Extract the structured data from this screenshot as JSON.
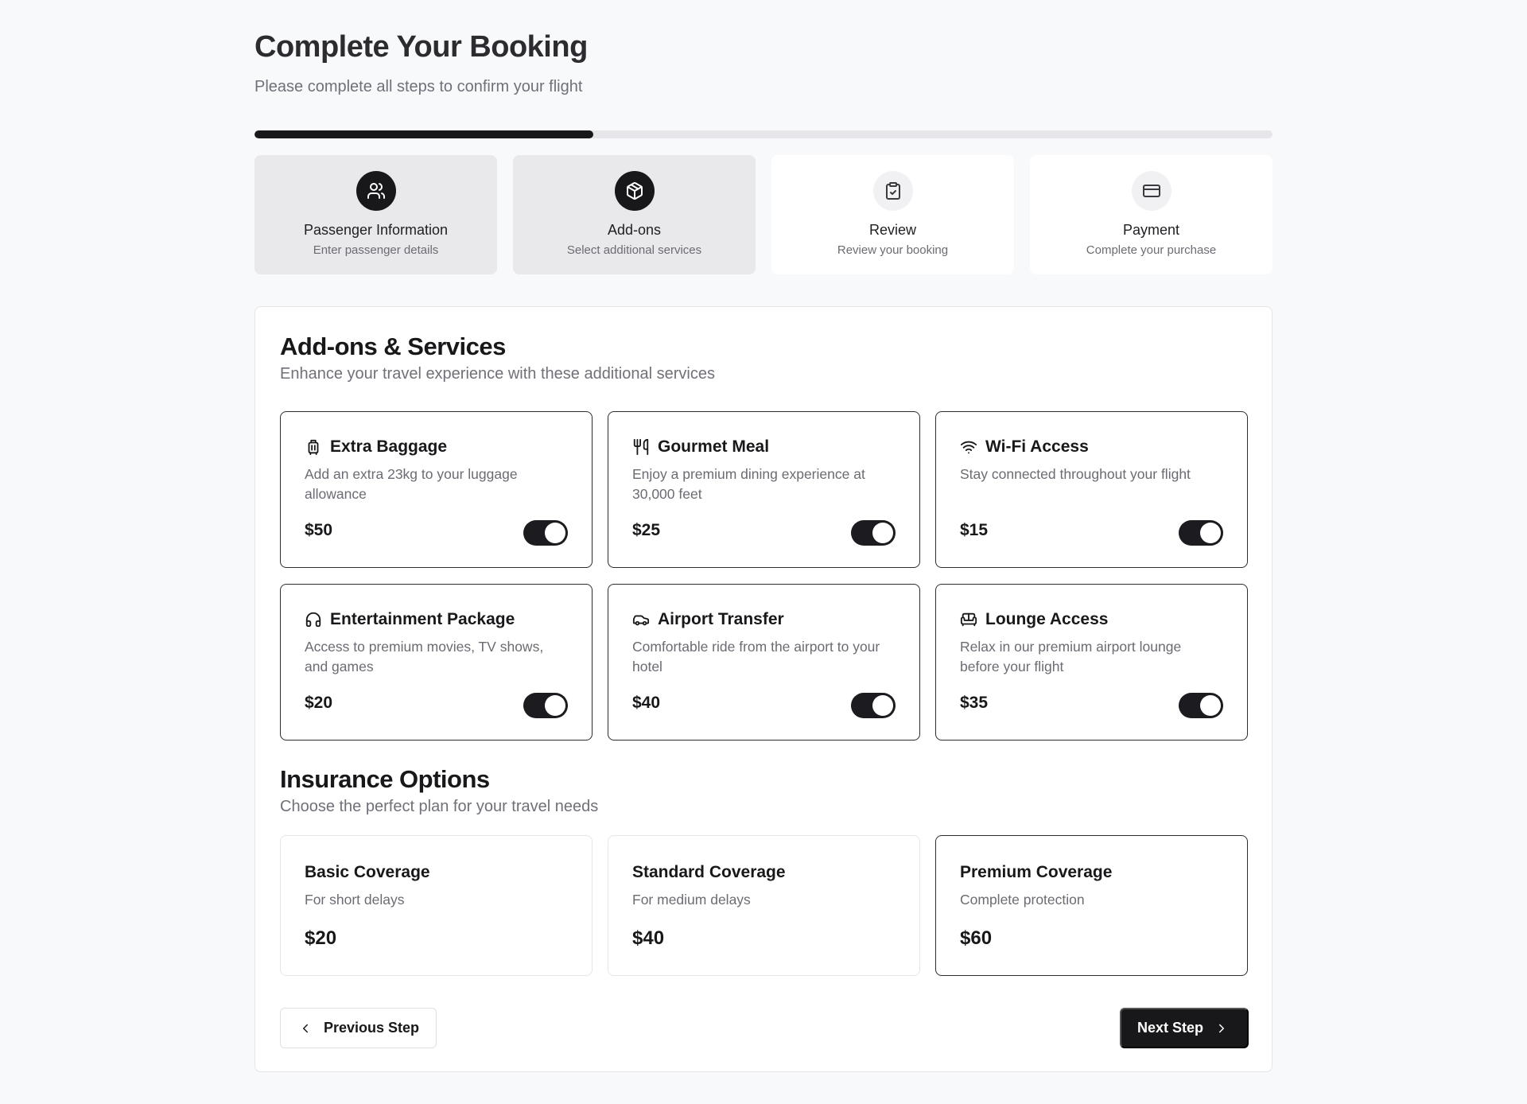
{
  "header": {
    "title": "Complete Your Booking",
    "subtitle": "Please complete all steps to confirm your flight"
  },
  "progress": {
    "percent": 33.3
  },
  "steps": [
    {
      "title": "Passenger Information",
      "subtitle": "Enter passenger details",
      "icon": "users-icon",
      "status": "done"
    },
    {
      "title": "Add-ons",
      "subtitle": "Select additional services",
      "icon": "package-icon",
      "status": "current"
    },
    {
      "title": "Review",
      "subtitle": "Review your booking",
      "icon": "clipboard-check-icon",
      "status": "upcoming"
    },
    {
      "title": "Payment",
      "subtitle": "Complete your purchase",
      "icon": "credit-card-icon",
      "status": "upcoming"
    }
  ],
  "addons": {
    "title": "Add-ons & Services",
    "subtitle": "Enhance your travel experience with these additional services",
    "items": [
      {
        "name": "Extra Baggage",
        "description": "Add an extra 23kg to your luggage allowance",
        "price": "$50",
        "icon": "luggage-icon",
        "enabled": true
      },
      {
        "name": "Gourmet Meal",
        "description": "Enjoy a premium dining experience at 30,000 feet",
        "price": "$25",
        "icon": "utensils-icon",
        "enabled": true
      },
      {
        "name": "Wi-Fi Access",
        "description": "Stay connected throughout your flight",
        "price": "$15",
        "icon": "wifi-icon",
        "enabled": true
      },
      {
        "name": "Entertainment Package",
        "description": "Access to premium movies, TV shows, and games",
        "price": "$20",
        "icon": "headphones-icon",
        "enabled": true
      },
      {
        "name": "Airport Transfer",
        "description": "Comfortable ride from the airport to your hotel",
        "price": "$40",
        "icon": "car-icon",
        "enabled": true
      },
      {
        "name": "Lounge Access",
        "description": "Relax in our premium airport lounge before your flight",
        "price": "$35",
        "icon": "sofa-icon",
        "enabled": true
      }
    ]
  },
  "insurance": {
    "title": "Insurance Options",
    "subtitle": "Choose the perfect plan for your travel needs",
    "options": [
      {
        "name": "Basic Coverage",
        "description": "For short delays",
        "price": "$20",
        "selected": false
      },
      {
        "name": "Standard Coverage",
        "description": "For medium delays",
        "price": "$40",
        "selected": false
      },
      {
        "name": "Premium Coverage",
        "description": "Complete protection",
        "price": "$60",
        "selected": true
      }
    ]
  },
  "nav": {
    "prev_label": "Previous Step",
    "next_label": "Next Step"
  },
  "colors": {
    "primary": "#18181b",
    "background": "#f8f9fb",
    "muted_text": "#707079",
    "border": "#e6e6ea"
  }
}
